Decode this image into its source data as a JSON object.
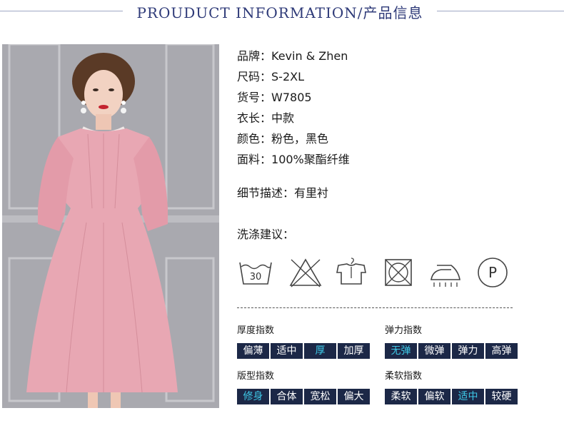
{
  "header": {
    "title": "PROUDUCT INFORMATION/产品信息"
  },
  "product_info": [
    {
      "label": "品牌：",
      "value": "Kevin & Zhen"
    },
    {
      "label": "尺码：",
      "value": "S-2XL"
    },
    {
      "label": "货号：",
      "value": "W7805"
    },
    {
      "label": "衣长：",
      "value": "中款"
    },
    {
      "label": "颜色：",
      "value": "粉色，黑色"
    },
    {
      "label": "面料：",
      "value": "100%聚酯纤维"
    }
  ],
  "detail": {
    "label": "细节描述：",
    "value": "有里衬"
  },
  "wash": {
    "title": "洗涤建议：",
    "tub_temperature": "30",
    "dryclean_letter": "P",
    "icons": [
      "wash-30-icon",
      "no-bleach-icon",
      "hang-dry-icon",
      "no-tumble-dry-icon",
      "iron-icon",
      "dry-clean-p-icon"
    ]
  },
  "metrics": {
    "thickness": {
      "label": "厚度指数",
      "options": [
        "偏薄",
        "适中",
        "厚",
        "加厚"
      ],
      "selected": "厚"
    },
    "elasticity": {
      "label": "弹力指数",
      "options": [
        "无弹",
        "微弹",
        "弹力",
        "高弹"
      ],
      "selected": "无弹"
    },
    "fit": {
      "label": "版型指数",
      "options": [
        "修身",
        "合体",
        "宽松",
        "偏大"
      ],
      "selected": "修身"
    },
    "softness": {
      "label": "柔软指数",
      "options": [
        "柔软",
        "偏软",
        "适中",
        "较硬"
      ],
      "selected": "适中"
    }
  },
  "colors": {
    "accent": "#2e3a78",
    "chip_bg": "#1c2847",
    "chip_selected_text": "#3ec8e6",
    "dress_pink": "#e8a7b3"
  }
}
